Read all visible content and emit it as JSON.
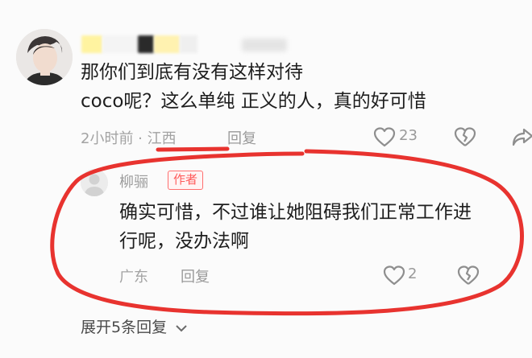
{
  "comment": {
    "text_line1": "那你们到底有没有这样对待",
    "text_line2": "coco呢？这么单纯 正义的人，真的好可惜",
    "time": "2小时前 · 江西",
    "reply_label": "回复",
    "like_count": "23"
  },
  "reply": {
    "username": "柳骊",
    "badge": "作者",
    "text_line1": "确实可惜，不过谁让她阻碍我们正常工作进",
    "text_line2": "行呢，没办法啊",
    "location": "广东",
    "reply_label": "回复",
    "like_count": "2"
  },
  "expand": {
    "label": "展开5条回复"
  },
  "colors": {
    "annotation_red": "#e8332f",
    "badge_red": "#ff5a5a",
    "meta_gray": "#a3a3a3"
  },
  "icons": [
    "avatar",
    "heart-icon",
    "broken-heart-icon",
    "share-icon",
    "chevron-down-icon"
  ]
}
